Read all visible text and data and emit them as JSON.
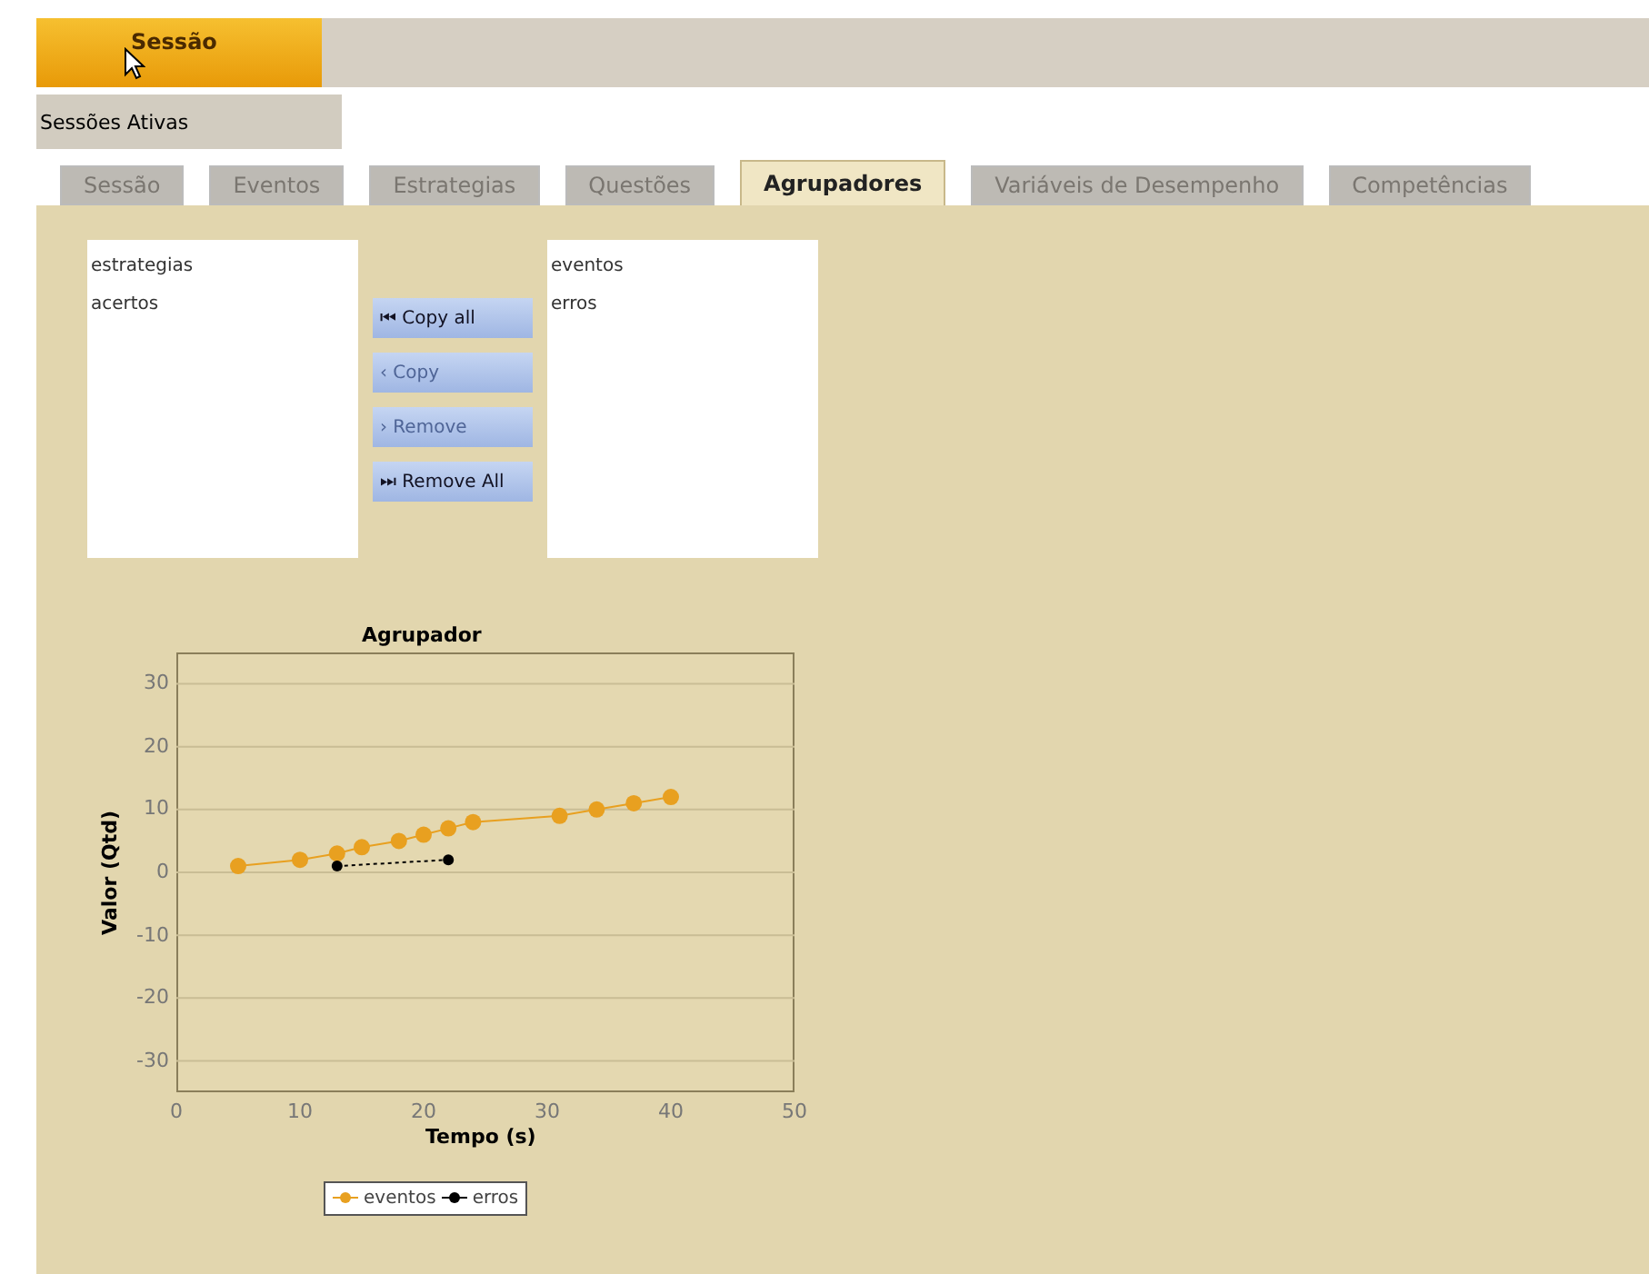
{
  "menu": {
    "label": "Sessão",
    "selected": true
  },
  "submenu": {
    "items": [
      {
        "label": "Sessões Ativas"
      }
    ]
  },
  "tabs": [
    {
      "label": "Sessão",
      "selected": false
    },
    {
      "label": "Eventos",
      "selected": false
    },
    {
      "label": "Estrategias",
      "selected": false
    },
    {
      "label": "Questões",
      "selected": false
    },
    {
      "label": "Agrupadores",
      "selected": true
    },
    {
      "label": "Variáveis de Desempenho",
      "selected": false
    },
    {
      "label": "Competências",
      "selected": false
    }
  ],
  "available_list": [
    "estrategias",
    "acertos"
  ],
  "buttons": [
    {
      "label": "Copy all",
      "icon": "⏮",
      "disabled": false
    },
    {
      "label": "Copy",
      "icon": "‹",
      "disabled": true
    },
    {
      "label": "Remove",
      "icon": "›",
      "disabled": true
    },
    {
      "label": "Remove All",
      "icon": "⏭",
      "disabled": false
    }
  ],
  "selected_list": [
    "eventos",
    "erros"
  ],
  "chart": {
    "chart_data": {
      "type": "line",
      "title": "Agrupador",
      "xlabel": "Tempo (s)",
      "ylabel": "Valor (Qtd)",
      "xlim": [
        0,
        50
      ],
      "ylim": [
        -35,
        35
      ],
      "xticks": [
        0,
        10,
        20,
        30,
        40,
        50
      ],
      "yticks": [
        -30,
        -20,
        -10,
        0,
        10,
        20,
        30
      ],
      "grid": true,
      "legend": "bottom",
      "series": [
        {
          "name": "eventos",
          "color": "#e8a020",
          "marker": "circle",
          "line_style": "solid",
          "x": [
            5,
            10,
            13,
            15,
            18,
            20,
            22,
            24,
            31,
            34,
            37,
            40
          ],
          "values": [
            1,
            2,
            3,
            4,
            5,
            6,
            7,
            8,
            9,
            10,
            11,
            12
          ]
        },
        {
          "name": "erros",
          "color": "#000000",
          "marker": "circle",
          "line_style": "dotted",
          "x": [
            13,
            22
          ],
          "values": [
            1,
            2
          ]
        }
      ]
    }
  }
}
